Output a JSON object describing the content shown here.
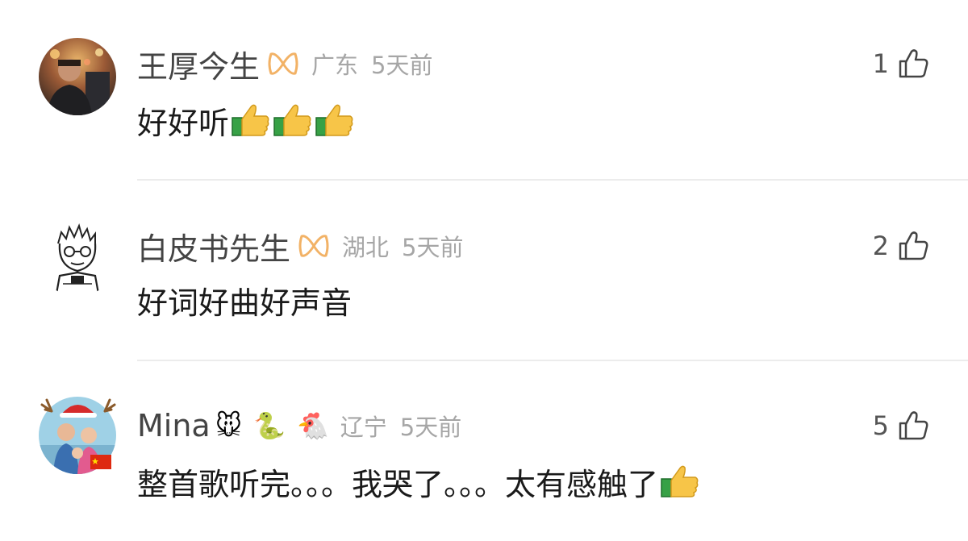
{
  "comments": [
    {
      "username": "王厚今生",
      "vip_icon": "vip-infinity-icon",
      "location": "广东",
      "time": "5天前",
      "text": "好好听",
      "content_emojis": [
        "thumbs-up-emoji",
        "thumbs-up-emoji",
        "thumbs-up-emoji"
      ],
      "likes": "1",
      "avatar": "photo-avatar"
    },
    {
      "username": "白皮书先生",
      "vip_icon": "vip-infinity-icon",
      "location": "湖北",
      "time": "5天前",
      "text": "好词好曲好声音",
      "likes": "2",
      "avatar": "sketch-avatar"
    },
    {
      "username": "Mina",
      "name_emojis": [
        "🐭",
        "🐍",
        "🐔"
      ],
      "location": "辽宁",
      "time": "5天前",
      "text": "整首歌听完。。。我哭了。。。太有感触了",
      "content_emojis": [
        "thumbs-up-emoji"
      ],
      "likes": "5",
      "avatar": "family-photo-avatar"
    }
  ],
  "colors": {
    "username": "#444444",
    "meta": "#a6a6a6",
    "content": "#1a1a1a",
    "vip": "#f2b266",
    "divider": "#ececec"
  }
}
